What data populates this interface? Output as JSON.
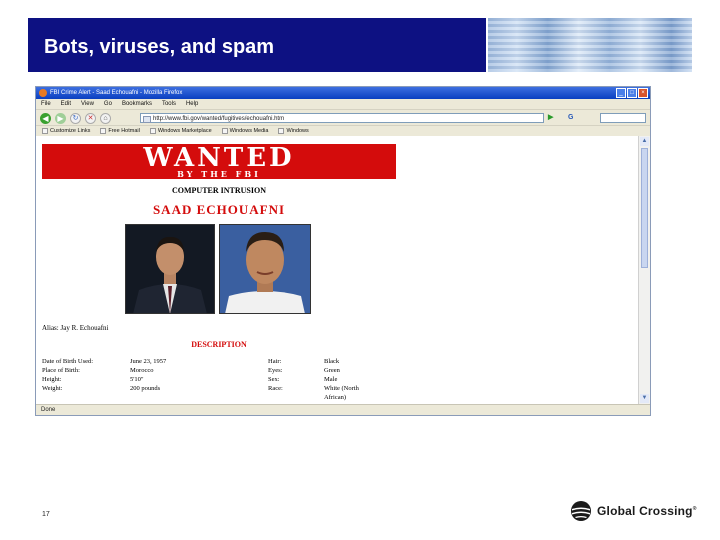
{
  "slide": {
    "title": "Bots, viruses, and spam",
    "number": "17",
    "logo_text": "Global Crossing",
    "logo_reg": "®",
    "colors": {
      "title_bar": "#0d1182",
      "wanted_red": "#d40c0c"
    }
  },
  "browser": {
    "window_title": "FBI Crime Alert - Saad Echouafni - Mozilla Firefox",
    "menu": [
      "File",
      "Edit",
      "View",
      "Go",
      "Bookmarks",
      "Tools",
      "Help"
    ],
    "url": "http://www.fbi.gov/wanted/fugitives/echouafni.htm",
    "search_placeholder": "",
    "bookmarks": [
      "Customize Links",
      "Free Hotmail",
      "Windows Marketplace",
      "Windows Media",
      "Windows"
    ],
    "status": "Done",
    "icons": {
      "back": "back-arrow-icon",
      "forward": "forward-arrow-icon",
      "reload": "reload-icon",
      "stop": "stop-icon",
      "home": "home-icon"
    }
  },
  "poster": {
    "wanted": "WANTED",
    "by_the_fbi": "BY THE FBI",
    "crime": "COMPUTER INTRUSION",
    "name": "SAAD ECHOUAFNI",
    "alias_label": "Alias:",
    "alias_value": "Jay R. Echouafni",
    "description_heading": "DESCRIPTION",
    "description": [
      {
        "label": "Date of Birth Used:",
        "value": "June 23, 1957",
        "label2": "Hair:",
        "value2": "Black"
      },
      {
        "label": "Place of Birth:",
        "value": "Morocco",
        "label2": "Eyes:",
        "value2": "Green"
      },
      {
        "label": "Height:",
        "value": "5'10\"",
        "label2": "Sex:",
        "value2": "Male"
      },
      {
        "label": "Weight:",
        "value": "200 pounds",
        "label2": "Race:",
        "value2": "White (North"
      },
      {
        "label": "",
        "value": "",
        "label2": "",
        "value2": "African)"
      }
    ]
  }
}
